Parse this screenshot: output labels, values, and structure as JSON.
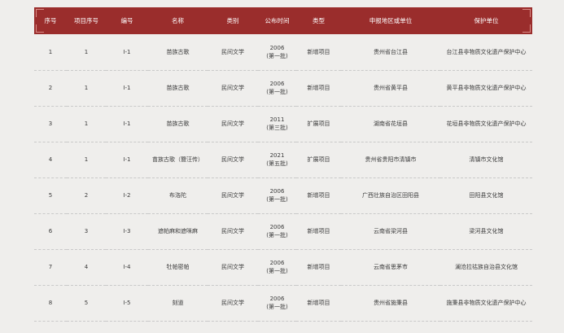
{
  "table": {
    "headers": [
      "序号",
      "项目序号",
      "编号",
      "名称",
      "类别",
      "公布时间",
      "类型",
      "申报地区或单位",
      "保护单位"
    ],
    "rows": [
      {
        "seq": "1",
        "proj_seq": "1",
        "code": "Ⅰ-1",
        "name": "苗族古歌",
        "category": "民间文学",
        "year": "2006",
        "batch": "(第一批)",
        "type": "新增项目",
        "region": "贵州省台江县",
        "protector": "台江县非物质文化遗产保护中心"
      },
      {
        "seq": "2",
        "proj_seq": "1",
        "code": "Ⅰ-1",
        "name": "苗族古歌",
        "category": "民间文学",
        "year": "2006",
        "batch": "(第一批)",
        "type": "新增项目",
        "region": "贵州省黄平县",
        "protector": "黄平县非物质文化遗产保护中心"
      },
      {
        "seq": "3",
        "proj_seq": "1",
        "code": "Ⅰ-1",
        "name": "苗族古歌",
        "category": "民间文学",
        "year": "2011",
        "batch": "(第三批)",
        "type": "扩展项目",
        "region": "湖南省花垣县",
        "protector": "花垣县非物质文化遗产保护中心"
      },
      {
        "seq": "4",
        "proj_seq": "1",
        "code": "Ⅰ-1",
        "name": "苗族古歌（簪汪传）",
        "category": "民间文学",
        "year": "2021",
        "batch": "(第五批)",
        "type": "扩展项目",
        "region": "贵州省贵阳市清镇市",
        "protector": "清镇市文化馆"
      },
      {
        "seq": "5",
        "proj_seq": "2",
        "code": "Ⅰ-2",
        "name": "布洛陀",
        "category": "民间文学",
        "year": "2006",
        "batch": "(第一批)",
        "type": "新增项目",
        "region": "广西壮族自治区田阳县",
        "protector": "田阳县文化馆"
      },
      {
        "seq": "6",
        "proj_seq": "3",
        "code": "Ⅰ-3",
        "name": "遮帕麻和遮咪麻",
        "category": "民间文学",
        "year": "2006",
        "batch": "(第一批)",
        "type": "新增项目",
        "region": "云南省梁河县",
        "protector": "梁河县文化馆"
      },
      {
        "seq": "7",
        "proj_seq": "4",
        "code": "Ⅰ-4",
        "name": "牡帕密帕",
        "category": "民间文学",
        "year": "2006",
        "batch": "(第一批)",
        "type": "新增项目",
        "region": "云南省思茅市",
        "protector": "澜沧拉祜族自治县文化馆"
      },
      {
        "seq": "8",
        "proj_seq": "5",
        "code": "Ⅰ-5",
        "name": "刻道",
        "category": "民间文学",
        "year": "2006",
        "batch": "(第一批)",
        "type": "新增项目",
        "region": "贵州省施秉县",
        "protector": "施秉县非物质文化遗产保护中心"
      }
    ]
  },
  "colors": {
    "header_bg": "#9a2d2c",
    "page_bg": "#efeeec"
  }
}
